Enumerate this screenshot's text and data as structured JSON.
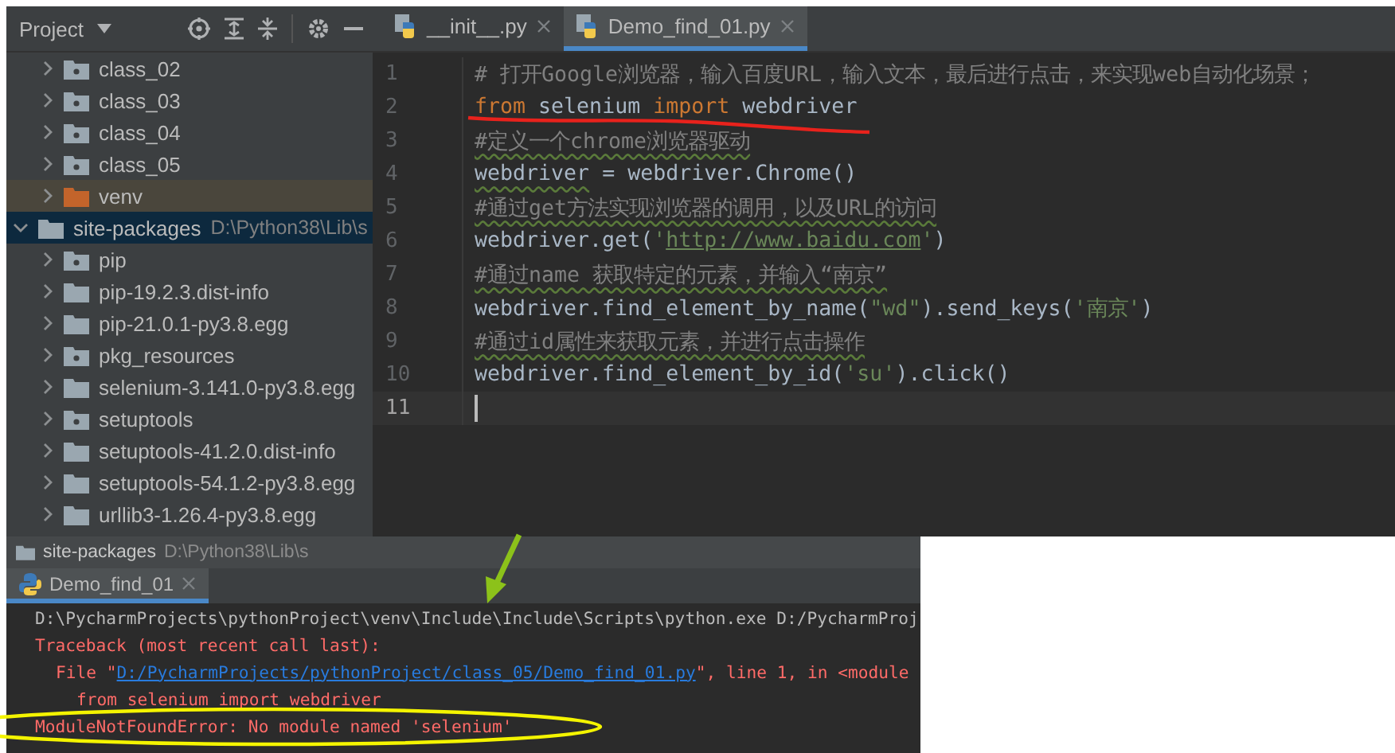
{
  "sidebar": {
    "title": "Project",
    "upper_rows": [
      {
        "label": "class_02",
        "kind": "package",
        "expanded": false,
        "selected": false
      },
      {
        "label": "class_03",
        "kind": "package",
        "expanded": false,
        "selected": false
      },
      {
        "label": "class_04",
        "kind": "package",
        "expanded": false,
        "selected": false
      },
      {
        "label": "class_05",
        "kind": "package",
        "expanded": false,
        "selected": false
      },
      {
        "label": "venv",
        "kind": "excluded",
        "expanded": false,
        "selected": false
      }
    ],
    "roots": [
      {
        "label": "site-packages",
        "path": "D:\\Python38\\Lib\\s",
        "kind": "folder",
        "expanded": true,
        "selected": true,
        "children": [
          {
            "label": "pip",
            "kind": "package",
            "expanded": false,
            "selected": false
          },
          {
            "label": "pip-19.2.3.dist-info",
            "kind": "folder",
            "expanded": false,
            "selected": false
          },
          {
            "label": "pip-21.0.1-py3.8.egg",
            "kind": "folder",
            "expanded": false,
            "selected": false
          },
          {
            "label": "pkg_resources",
            "kind": "package",
            "expanded": false,
            "selected": false
          },
          {
            "label": "selenium-3.141.0-py3.8.egg",
            "kind": "folder",
            "expanded": false,
            "selected": false
          },
          {
            "label": "setuptools",
            "kind": "package",
            "expanded": false,
            "selected": false
          },
          {
            "label": "setuptools-41.2.0.dist-info",
            "kind": "folder",
            "expanded": false,
            "selected": false
          },
          {
            "label": "setuptools-54.1.2-py3.8.egg",
            "kind": "folder",
            "expanded": false,
            "selected": false
          },
          {
            "label": "urllib3-1.26.4-py3.8.egg",
            "kind": "folder",
            "expanded": false,
            "selected": false
          }
        ]
      }
    ]
  },
  "editor": {
    "tabs": [
      {
        "label": "__init__.py",
        "selected": false
      },
      {
        "label": "Demo_find_01.py",
        "selected": true
      }
    ],
    "lines": [
      {
        "number": "1",
        "current": false,
        "tokens": [
          {
            "kind": "comment",
            "text": "# 打开Google浏览器，输入百度URL，输入文本，最后进行点击，来实现web自动化场景；"
          }
        ]
      },
      {
        "number": "2",
        "current": false,
        "tokens": [
          {
            "kind": "keyword",
            "text": "from"
          },
          {
            "kind": "plain",
            "text": " selenium "
          },
          {
            "kind": "keyword",
            "text": "import"
          },
          {
            "kind": "plain",
            "text": " webdriver"
          }
        ]
      },
      {
        "number": "3",
        "current": false,
        "tokens": [
          {
            "kind": "comment_warn",
            "text": "#定义一个chrome浏览器驱动"
          }
        ]
      },
      {
        "number": "4",
        "current": false,
        "tokens": [
          {
            "kind": "plain_warn",
            "text": "webdriver"
          },
          {
            "kind": "plain",
            "text": " = webdriver.Chrome()"
          }
        ]
      },
      {
        "number": "5",
        "current": false,
        "tokens": [
          {
            "kind": "comment_warn",
            "text": "#通过get方法实现浏览器的调用，以及URL的访问"
          }
        ]
      },
      {
        "number": "6",
        "current": false,
        "tokens": [
          {
            "kind": "plain",
            "text": "webdriver.get("
          },
          {
            "kind": "string",
            "text": "'"
          },
          {
            "kind": "url",
            "text": "http://www.baidu.com"
          },
          {
            "kind": "string",
            "text": "'"
          },
          {
            "kind": "plain",
            "text": ")"
          }
        ]
      },
      {
        "number": "7",
        "current": false,
        "tokens": [
          {
            "kind": "comment_warn",
            "text": "#通过name 获取特定的元素，并输入“南京”"
          }
        ]
      },
      {
        "number": "8",
        "current": false,
        "tokens": [
          {
            "kind": "plain",
            "text": "webdriver.find_element_by_name("
          },
          {
            "kind": "string",
            "text": "\"wd\""
          },
          {
            "kind": "plain",
            "text": ").send_keys("
          },
          {
            "kind": "string",
            "text": "'南京'"
          },
          {
            "kind": "plain",
            "text": ")"
          }
        ]
      },
      {
        "number": "9",
        "current": false,
        "tokens": [
          {
            "kind": "comment_warn",
            "text": "#通过id属性来获取元素，并进行点击操作"
          }
        ]
      },
      {
        "number": "10",
        "current": false,
        "tokens": [
          {
            "kind": "plain",
            "text": "webdriver.find_element_by_id("
          },
          {
            "kind": "string",
            "text": "'su'"
          },
          {
            "kind": "plain",
            "text": ").click()"
          }
        ]
      },
      {
        "number": "11",
        "current": true
      }
    ]
  },
  "run_panel": {
    "header_label": "site-packages",
    "header_path": "D:\\Python38\\Lib\\s",
    "tabs": [
      {
        "label": "Demo_find_01",
        "selected": true
      }
    ],
    "console": [
      {
        "kind": "command",
        "text": "D:\\PycharmProjects\\pythonProject\\venv\\Include\\Include\\Scripts\\python.exe D:/PycharmProj"
      },
      {
        "kind": "error",
        "text": "Traceback (most recent call last):"
      },
      {
        "kind": "file_ref",
        "prefix": "File \"",
        "link": "D:/PycharmProjects/pythonProject/class_05/Demo_find_01.py",
        "suffix": "\", line 1, in <module"
      },
      {
        "kind": "error_source",
        "text": "from selenium import webdriver"
      },
      {
        "kind": "error",
        "text": "ModuleNotFoundError: No module named 'selenium'"
      }
    ]
  }
}
